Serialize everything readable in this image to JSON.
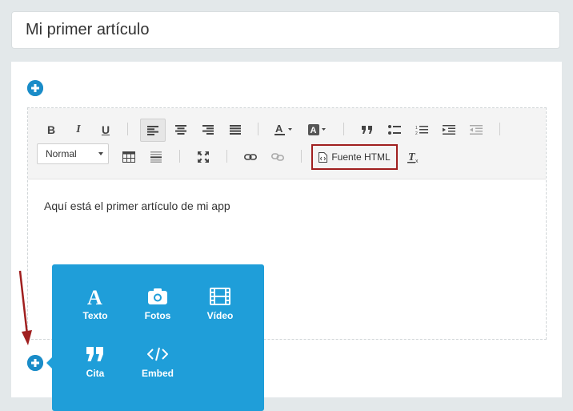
{
  "title_field": {
    "value": "Mi primer artículo"
  },
  "toolbar": {
    "bold": "B",
    "italic": "I",
    "underline": "U",
    "format_select": "Normal",
    "source_button": "Fuente HTML"
  },
  "editor": {
    "content": "Aquí está el primer artículo de mi app"
  },
  "insert_menu": {
    "items": [
      {
        "label": "Texto",
        "icon": "text-icon"
      },
      {
        "label": "Fotos",
        "icon": "camera-icon"
      },
      {
        "label": "Vídeo",
        "icon": "film-icon"
      },
      {
        "label": "Cita",
        "icon": "quote-icon"
      },
      {
        "label": "Embed",
        "icon": "code-icon"
      }
    ]
  },
  "colors": {
    "accent_blue": "#1f9ed9",
    "plus_button": "#1a8cc8",
    "highlight_red": "#a01f1f",
    "background": "#e3e8ea"
  }
}
